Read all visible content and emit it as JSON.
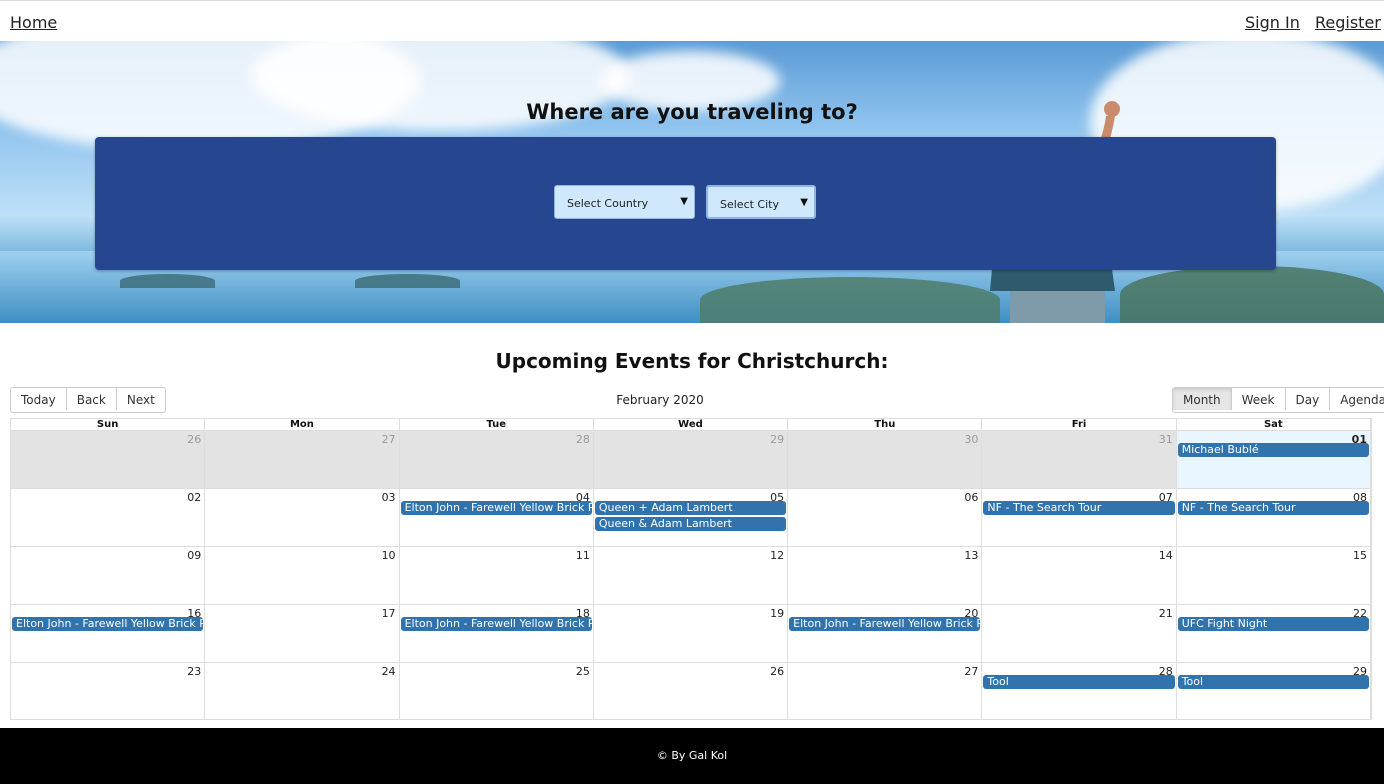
{
  "nav": {
    "home": "Home",
    "signin": "Sign In",
    "register": "Register"
  },
  "hero": {
    "title": "Where are you traveling to?",
    "country_select": "Select Country",
    "city_select": "Select City",
    "arrow": "▼"
  },
  "events": {
    "title": "Upcoming Events for Christchurch:",
    "toolbar": {
      "today": "Today",
      "back": "Back",
      "next": "Next",
      "month": "Month",
      "week": "Week",
      "day": "Day",
      "agenda": "Agenda",
      "active_view": "Month"
    },
    "month_label": "February 2020",
    "weekdays": [
      "Sun",
      "Mon",
      "Tue",
      "Wed",
      "Thu",
      "Fri",
      "Sat"
    ],
    "weeks": [
      [
        "26",
        "27",
        "28",
        "29",
        "30",
        "31",
        "01"
      ],
      [
        "02",
        "03",
        "04",
        "05",
        "06",
        "07",
        "08"
      ],
      [
        "09",
        "10",
        "11",
        "12",
        "13",
        "14",
        "15"
      ],
      [
        "16",
        "17",
        "18",
        "19",
        "20",
        "21",
        "22"
      ],
      [
        "23",
        "24",
        "25",
        "26",
        "27",
        "28",
        "29"
      ]
    ],
    "event_list": [
      {
        "week": 0,
        "day": 6,
        "slot": 0,
        "title": "Michael Bublé"
      },
      {
        "week": 1,
        "day": 2,
        "slot": 0,
        "title": "Elton John - Farewell Yellow Brick Road"
      },
      {
        "week": 1,
        "day": 3,
        "slot": 0,
        "title": "Queen + Adam Lambert"
      },
      {
        "week": 1,
        "day": 3,
        "slot": 1,
        "title": "Queen & Adam Lambert"
      },
      {
        "week": 1,
        "day": 5,
        "slot": 0,
        "title": "NF - The Search Tour"
      },
      {
        "week": 1,
        "day": 6,
        "slot": 0,
        "title": "NF - The Search Tour"
      },
      {
        "week": 3,
        "day": 0,
        "slot": 0,
        "title": "Elton John - Farewell Yellow Brick Road"
      },
      {
        "week": 3,
        "day": 2,
        "slot": 0,
        "title": "Elton John - Farewell Yellow Brick Road"
      },
      {
        "week": 3,
        "day": 4,
        "slot": 0,
        "title": "Elton John - Farewell Yellow Brick Road"
      },
      {
        "week": 3,
        "day": 6,
        "slot": 0,
        "title": "UFC Fight Night"
      },
      {
        "week": 4,
        "day": 5,
        "slot": 0,
        "title": "Tool"
      },
      {
        "week": 4,
        "day": 6,
        "slot": 0,
        "title": "Tool"
      }
    ]
  },
  "footer": {
    "text": "© By Gal Kol"
  },
  "colors": {
    "panel": "#26478f",
    "event": "#3174ad",
    "footer": "#000000"
  }
}
